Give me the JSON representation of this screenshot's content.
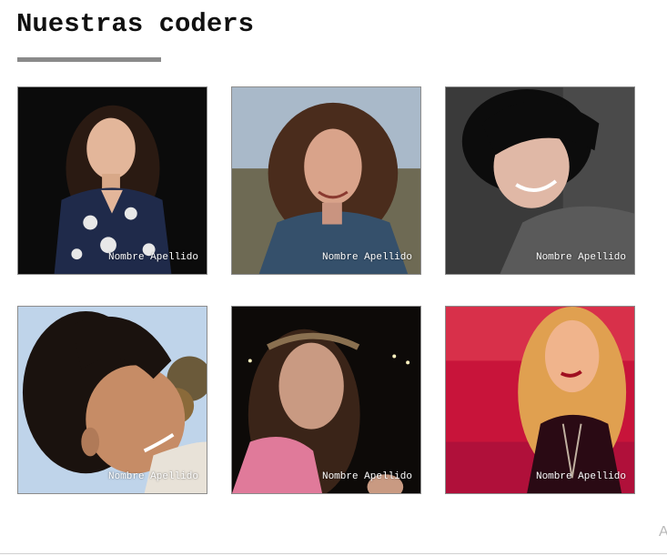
{
  "header": {
    "title": "Nuestras coders"
  },
  "coders": [
    {
      "name": "Nombre Apellido",
      "photo": "portrait-photo",
      "bg": "#0b0b0b",
      "skin": "#e3b69a",
      "hair": "#2a1a12",
      "cloth": "#1f2a4a"
    },
    {
      "name": "Nombre Apellido",
      "photo": "portrait-photo",
      "bg": "#a9b9c9",
      "skin": "#d9a38a",
      "hair": "#4a2c1c",
      "cloth": "#35506b"
    },
    {
      "name": "Nombre Apellido",
      "photo": "portrait-photo",
      "bg": "#3a3a3a",
      "skin": "#e0b8a6",
      "hair": "#0c0c0c",
      "cloth": "#5a5a5a"
    },
    {
      "name": "Nombre Apellido",
      "photo": "portrait-photo",
      "bg": "#bfd4ea",
      "skin": "#c68c66",
      "hair": "#1a120e",
      "cloth": "#e8e2d8"
    },
    {
      "name": "Nombre Apellido",
      "photo": "portrait-photo",
      "bg": "#0d0a08",
      "skin": "#c99a82",
      "hair": "#3a2418",
      "cloth": "#e07a9a"
    },
    {
      "name": "Nombre Apellido",
      "photo": "portrait-photo",
      "bg": "#c8143a",
      "skin": "#f0b48c",
      "hair": "#e0a050",
      "cloth": "#2a0a14"
    }
  ],
  "footer": {
    "edge_glyph": "A"
  }
}
